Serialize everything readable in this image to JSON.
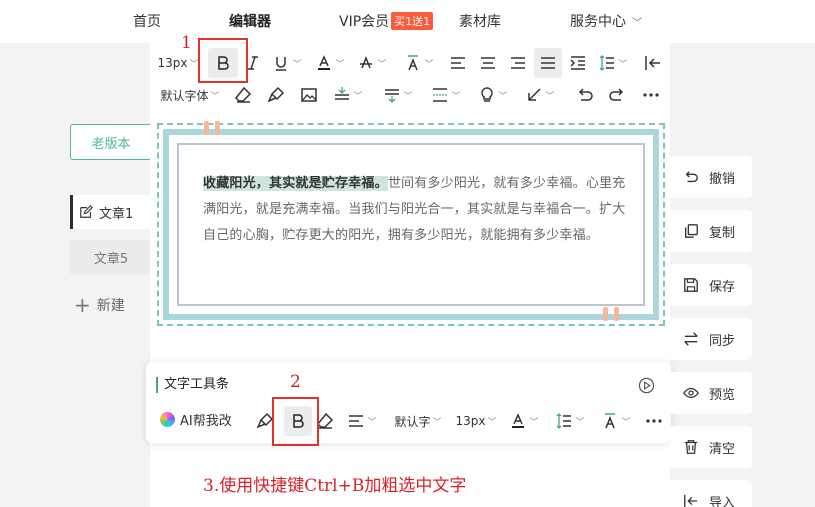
{
  "nav": {
    "home": "首页",
    "editor": "编辑器",
    "vip": "VIP会员",
    "vip_badge": "买1送1",
    "materials": "素材库",
    "service": "服务中心"
  },
  "sidebar": {
    "old_version": "老版本",
    "articles": [
      "文章1",
      "文章5"
    ],
    "new_article": "新建"
  },
  "toolbar": {
    "font_size": "13px",
    "font_family": "默认字体"
  },
  "annotations": {
    "one": "1",
    "two": "2",
    "hint": "3.使用快捷键Ctrl+B加粗选中文字"
  },
  "template": {
    "highlighted": "收藏阳光，其实就是贮存幸福。",
    "rest": "世间有多少阳光，就有多少幸福。心里充满阳光，就是充满幸福。当我们与阳光合一，其实就是与幸福合一。扩大自己的心胸，贮存更大的阳光，拥有多少阳光，就能拥有多少幸福。"
  },
  "text_panel": {
    "title": "文字工具条",
    "ai_label": "AI帮我改",
    "font_family": "默认字",
    "font_size": "13px"
  },
  "side_actions": [
    "撤销",
    "复制",
    "保存",
    "同步",
    "预览",
    "清空",
    "导入"
  ],
  "colors": {
    "accent_green": "#4fb59a",
    "annotation_red": "#e4302b",
    "vip_orange": "#ff5a3c",
    "highlight": "#cfe6df"
  }
}
